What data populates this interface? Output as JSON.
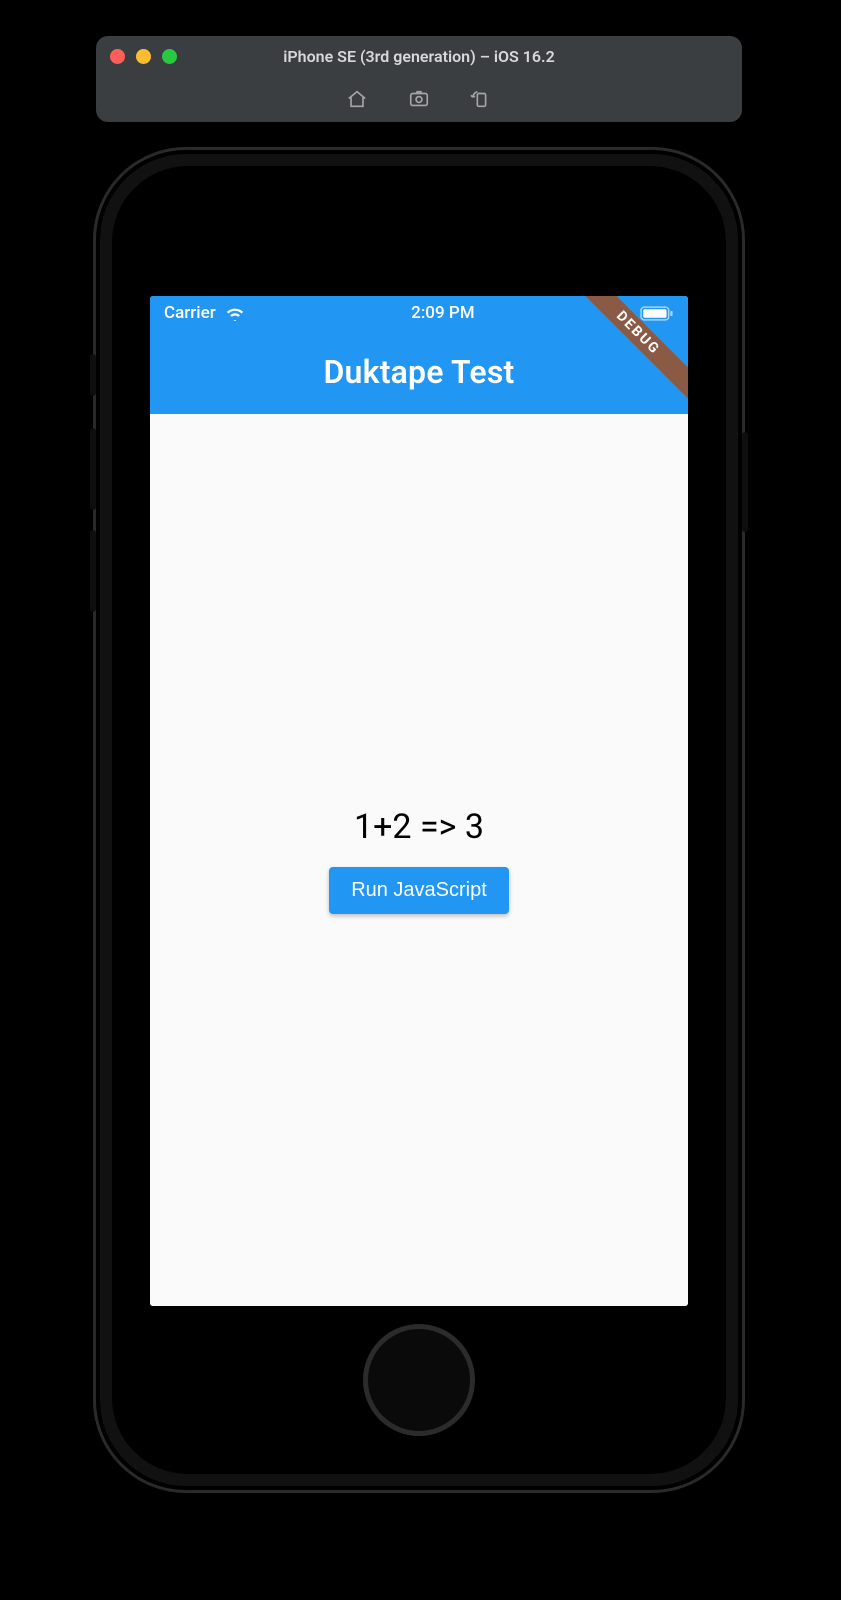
{
  "simulator": {
    "title": "iPhone SE (3rd generation) – iOS 16.2",
    "traffic_lights": [
      "close",
      "minimize",
      "zoom"
    ],
    "tools": {
      "home": "home-icon",
      "screenshot": "screenshot-icon",
      "rotate": "rotate-icon"
    }
  },
  "status_bar": {
    "carrier": "Carrier",
    "signal_icon": "wifi-icon",
    "time": "2:09 PM",
    "battery_icon": "battery-full"
  },
  "app": {
    "title": "Duktape Test",
    "debug_banner": "DEBUG",
    "result_text": "1+2 => 3",
    "run_button_label": "Run JavaScript"
  },
  "colors": {
    "accent": "#2196f3",
    "banner": "#8a5a44",
    "background": "#fafafa"
  }
}
